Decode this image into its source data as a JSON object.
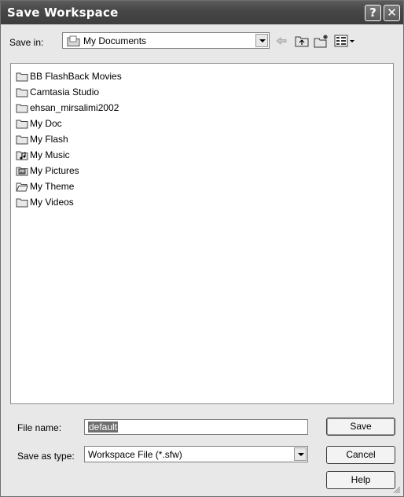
{
  "window": {
    "title": "Save Workspace",
    "help_glyph": "?",
    "close_glyph": "✕"
  },
  "save_in": {
    "label": "Save in:",
    "value": "My Documents",
    "icon": "documents-folder-icon"
  },
  "toolbar": {
    "back": "back-arrow-icon",
    "up": "up-folder-icon",
    "new_folder": "new-folder-icon",
    "views": "views-menu-icon"
  },
  "files": [
    {
      "name": "BB FlashBack Movies",
      "icon": "folder-icon"
    },
    {
      "name": "Camtasia Studio",
      "icon": "folder-icon"
    },
    {
      "name": "ehsan_mirsalimi2002",
      "icon": "folder-icon"
    },
    {
      "name": "My Doc",
      "icon": "folder-icon"
    },
    {
      "name": "My Flash",
      "icon": "folder-icon"
    },
    {
      "name": "My Music",
      "icon": "music-folder-icon"
    },
    {
      "name": "My Pictures",
      "icon": "pictures-folder-icon"
    },
    {
      "name": "My Theme",
      "icon": "open-folder-icon"
    },
    {
      "name": "My Videos",
      "icon": "folder-icon"
    }
  ],
  "file_name": {
    "label": "File name:",
    "value": "default"
  },
  "save_as_type": {
    "label": "Save as type:",
    "value": "Workspace File (*.sfw)"
  },
  "buttons": {
    "save": "Save",
    "cancel": "Cancel",
    "help": "Help"
  }
}
